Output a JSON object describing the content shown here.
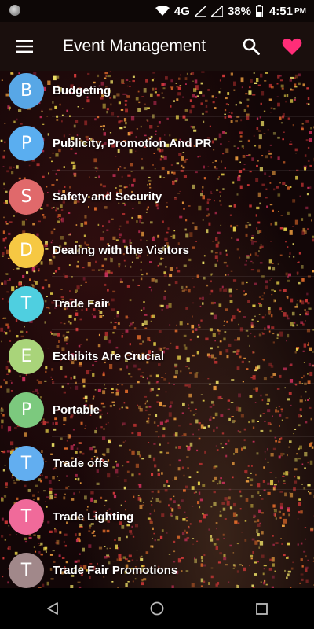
{
  "status_bar": {
    "network": "4G",
    "battery": "38%",
    "time": "4:51",
    "ampm": "PM"
  },
  "toolbar": {
    "title": "Event Management",
    "menu_icon": "hamburger-menu-icon",
    "search_icon": "search-icon",
    "favorite_icon": "heart-icon",
    "favorite_color": "#ff2d78"
  },
  "topics": [
    {
      "letter": "B",
      "label": "Budgeting",
      "color": "#58a7e6"
    },
    {
      "letter": "P",
      "label": "Publicity, Promotion And PR",
      "color": "#5aaef0"
    },
    {
      "letter": "S",
      "label": "Safety and Security",
      "color": "#e0696b"
    },
    {
      "letter": "D",
      "label": "Dealing with the Visitors",
      "color": "#f6c843"
    },
    {
      "letter": "T",
      "label": "Trade Fair",
      "color": "#4fcfe0"
    },
    {
      "letter": "E",
      "label": "Exhibits Are Crucial",
      "color": "#a9d47a"
    },
    {
      "letter": "P",
      "label": "Portable",
      "color": "#7cc97e"
    },
    {
      "letter": "T",
      "label": "Trade offs",
      "color": "#62aef0"
    },
    {
      "letter": "T",
      "label": "Trade Lighting",
      "color": "#f06a9a"
    },
    {
      "letter": "T",
      "label": "Trade Fair Promotions",
      "color": "#a1888a"
    }
  ],
  "nav_bar": {
    "back_icon": "back-triangle-icon",
    "home_icon": "home-circle-icon",
    "recents_icon": "recents-square-icon"
  }
}
